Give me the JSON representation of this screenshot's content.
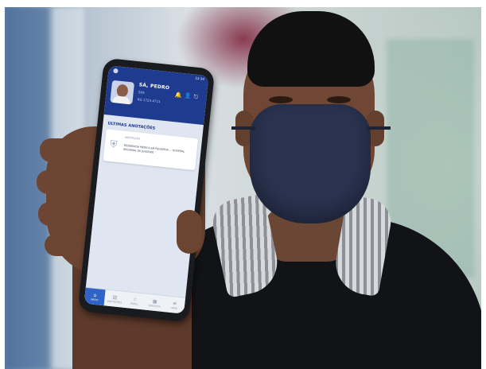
{
  "app": {
    "user_name": "SÁ, PEDRO",
    "user_sub": "SRS",
    "user_id": "RG 1723-4711",
    "status_time": "12:34",
    "section_title": "ÚLTIMAS ANOTAÇÕES",
    "card_label": "ANOTAÇÃO",
    "card_text": "RESIDÊNCIA MÉDICA EM PEDIATRIA — HOSPITAL REGIONAL DE JUAZEIRO",
    "nav": [
      "INÍCIO",
      "ANOTAÇÕES",
      "ESPEC.",
      "SERVIÇOS",
      "MAIS"
    ]
  },
  "icons": {
    "header": [
      "bell-icon",
      "person-icon",
      "logout-icon"
    ],
    "card": "shield-icon",
    "nav": [
      "home-icon",
      "document-icon",
      "star-icon",
      "grid-icon",
      "menu-icon"
    ]
  },
  "colors": {
    "header_blue": "#1f3b8f",
    "nav_active": "#2f63c8",
    "mask": "#2a3350",
    "shirt": "#121316"
  }
}
